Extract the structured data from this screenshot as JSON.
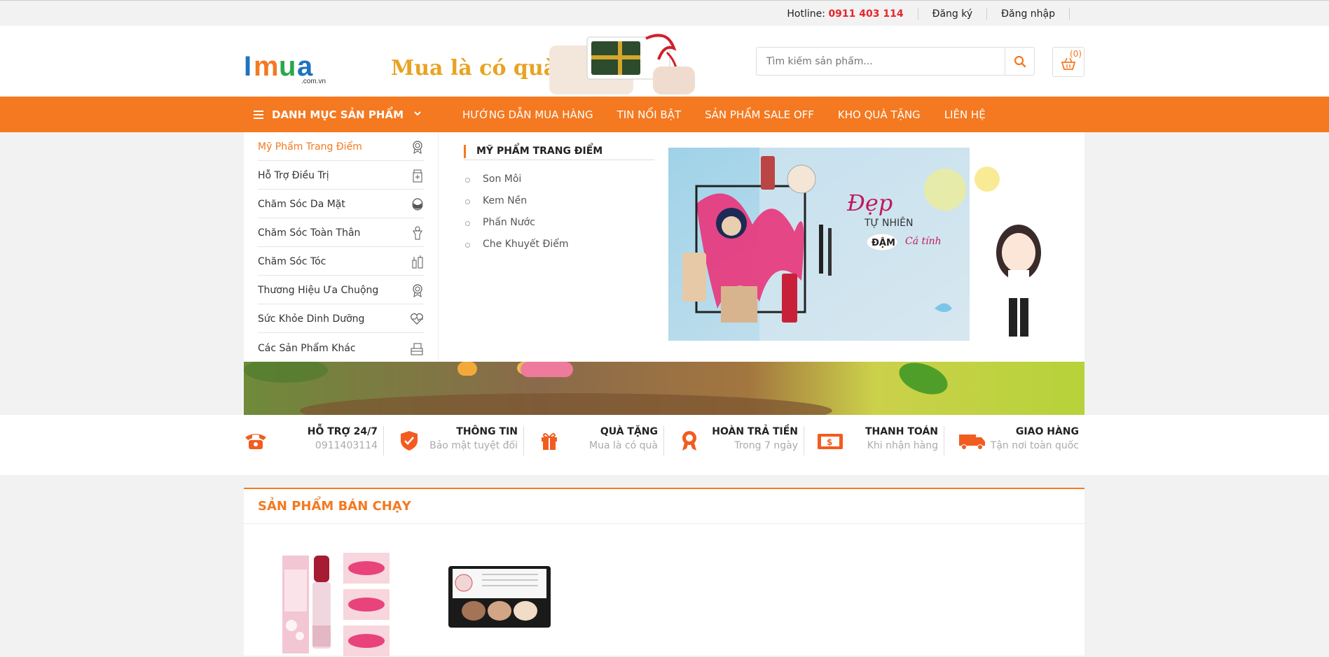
{
  "topbar": {
    "hotline_label": "Hotline:",
    "hotline_number": "0911 403 114",
    "register": "Đăng ký",
    "login": "Đăng nhập"
  },
  "header": {
    "logo_text": "IMUA",
    "logo_sub": ".com.vn",
    "promo_text": "Mua là có quà",
    "search_placeholder": "Tìm kiếm sản phẩm...",
    "cart_count": "(0)"
  },
  "nav": {
    "category_label": "DANH MỤC SẢN PHẨM",
    "links": [
      "HƯỚNG DẪN MUA HÀNG",
      "TIN NỔI BẬT",
      "SẢN PHẨM SALE OFF",
      "KHO QUÀ TẶNG",
      "LIÊN HỆ"
    ]
  },
  "categories": [
    {
      "label": "Mỹ Phẩm Trang Điểm",
      "icon": "badge-icon",
      "active": true
    },
    {
      "label": "Hỗ Trợ Điều Trị",
      "icon": "medicine-icon"
    },
    {
      "label": "Chăm Sóc Da Mặt",
      "icon": "face-mask-icon"
    },
    {
      "label": "Chăm Sóc Toàn Thân",
      "icon": "body-icon"
    },
    {
      "label": "Chăm Sóc Tóc",
      "icon": "hair-products-icon"
    },
    {
      "label": "Thương Hiệu Ưa Chuộng",
      "icon": "badge-icon"
    },
    {
      "label": "Sức Khỏe Dinh Dưỡng",
      "icon": "heart-pulse-icon"
    },
    {
      "label": "Các Sản Phẩm Khác",
      "icon": "boxes-icon"
    }
  ],
  "submenu": {
    "title": "MỸ PHẨM TRANG ĐIỂM",
    "items": [
      "Son Môi",
      "Kem Nền",
      "Phấn Nước",
      "Che Khuyết Điểm"
    ]
  },
  "mega_banner": {
    "line1": "Đẹp",
    "line2": "TỰ NHIÊN",
    "line3": "ĐẬM",
    "line4": "Cá tính"
  },
  "features": [
    {
      "title": "HỖ TRỢ 24/7",
      "desc": "0911403114",
      "icon": "phone-icon"
    },
    {
      "title": "THÔNG TIN",
      "desc": "Bảo mật tuyệt đối",
      "icon": "shield-icon"
    },
    {
      "title": "QUÀ TẶNG",
      "desc": "Mua là có quà",
      "icon": "gift-icon"
    },
    {
      "title": "HOÀN TRẢ TIỀN",
      "desc": "Trong 7 ngày",
      "icon": "award-icon"
    },
    {
      "title": "THANH TOÁN",
      "desc": "Khi nhận hàng",
      "icon": "cash-icon"
    },
    {
      "title": "GIAO HÀNG",
      "desc": "Tận nơi toàn quốc",
      "icon": "truck-icon"
    }
  ],
  "bestseller": {
    "title": "SẢN PHẨM BÁN CHẠY"
  },
  "colors": {
    "accent": "#f47920",
    "hotline": "#e5262c"
  }
}
